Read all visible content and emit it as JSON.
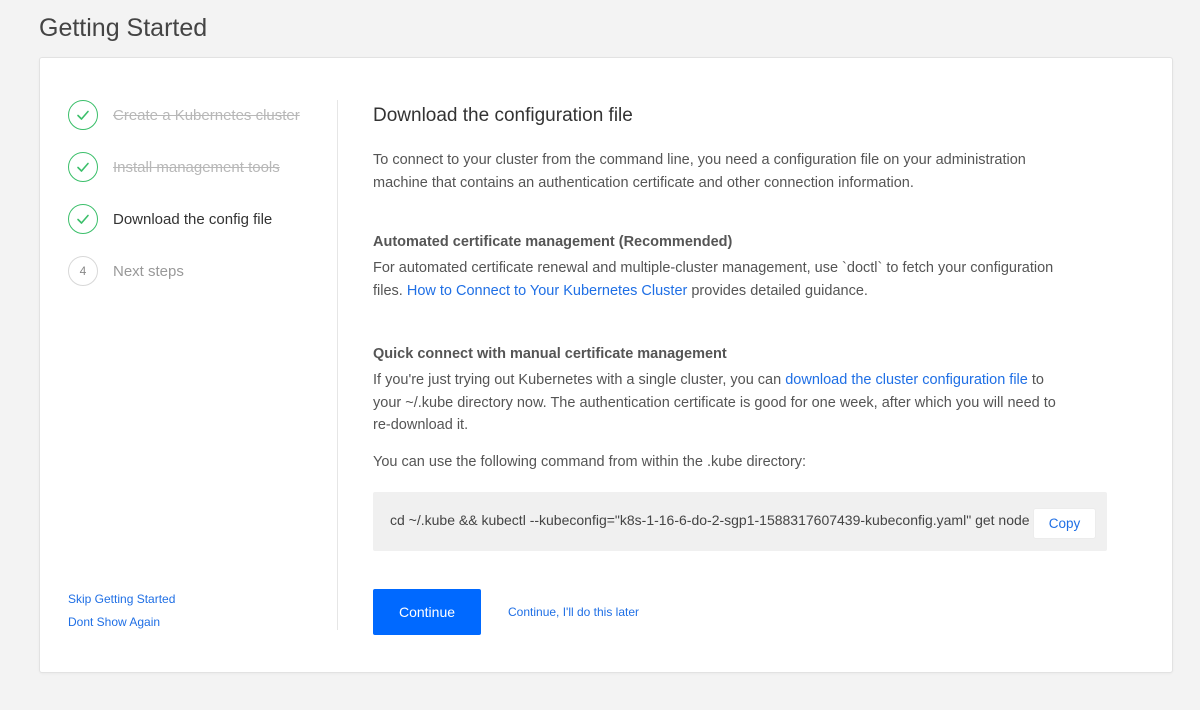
{
  "page": {
    "title": "Getting Started"
  },
  "steps": [
    {
      "label": "Create a Kubernetes cluster",
      "state": "done"
    },
    {
      "label": "Install management tools",
      "state": "done"
    },
    {
      "label": "Download the config file",
      "state": "current"
    },
    {
      "number": "4",
      "label": "Next steps",
      "state": "pending"
    }
  ],
  "footer": {
    "skip": "Skip Getting Started",
    "dont_show": "Dont Show Again"
  },
  "content": {
    "title": "Download the configuration file",
    "intro": "To connect to your cluster from the command line, you need a configuration file on your administration machine that contains an authentication certificate and other connection information.",
    "automated": {
      "heading": "Automated certificate management (Recommended)",
      "text_before": "For automated certificate renewal and multiple-cluster management, use `doctl` to fetch your configuration files. ",
      "link": "How to Connect to Your Kubernetes Cluster",
      "text_after": " provides detailed guidance."
    },
    "quick": {
      "heading": "Quick connect with manual certificate management",
      "text_before": "If you're just trying out Kubernetes with a single cluster, you can ",
      "link": "download the cluster configuration file",
      "text_after": " to your ~/.kube directory now. The authentication certificate is good for one week, after which you will need to re-download it."
    },
    "command_intro": "You can use the following command from within the .kube directory:",
    "command": "cd ~/.kube && kubectl --kubeconfig=\"k8s-1-16-6-do-2-sgp1-1588317607439-kubeconfig.yaml\" get nodes",
    "copy_label": "Copy",
    "continue_label": "Continue",
    "later_label": "Continue, I'll do this later"
  },
  "colors": {
    "accent": "#0069ff",
    "link": "#1f6fe5",
    "done": "#3bbf6a"
  }
}
